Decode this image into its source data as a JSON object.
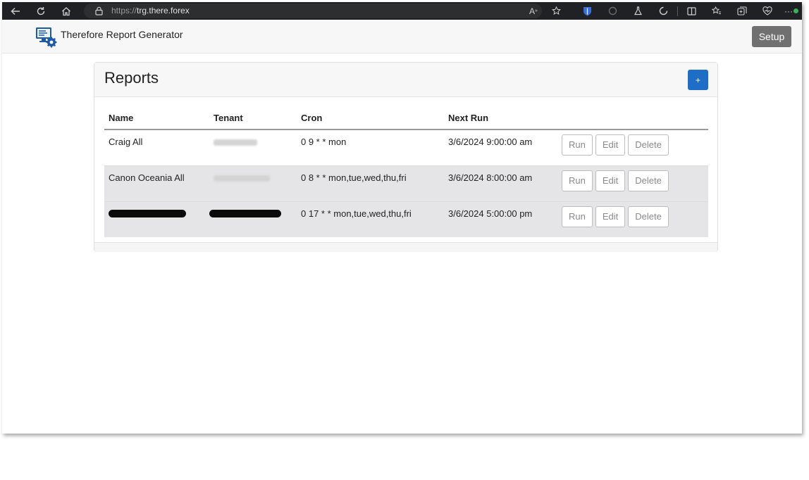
{
  "browser": {
    "url_protocol": "https://",
    "url_host": "trg.there.forex",
    "read_aloud_label": "A",
    "more_label": "···"
  },
  "app": {
    "title": "Therefore Report Generator",
    "setup_label": "Setup"
  },
  "reports": {
    "title": "Reports",
    "add_label": "+",
    "columns": [
      "Name",
      "Tenant",
      "Cron",
      "Next Run"
    ],
    "rows": [
      {
        "name": "Craig All",
        "cron": "0 9 * * mon",
        "next_run": "3/6/2024 9:00:00 am"
      },
      {
        "name": "Canon Oceania All",
        "cron": "0 8 * * mon,tue,wed,thu,fri",
        "next_run": "3/6/2024 8:00:00 am"
      },
      {
        "name": "",
        "cron": "0 17 * * mon,tue,wed,thu,fri",
        "next_run": "3/6/2024 5:00:00 pm"
      }
    ],
    "actions": {
      "run": "Run",
      "edit": "Edit",
      "delete": "Delete"
    }
  },
  "colors": {
    "chrome_bg": "#202124",
    "primary": "#1e6ec8",
    "setup_bg": "#707070",
    "row_alt": "#e5e5e7"
  }
}
